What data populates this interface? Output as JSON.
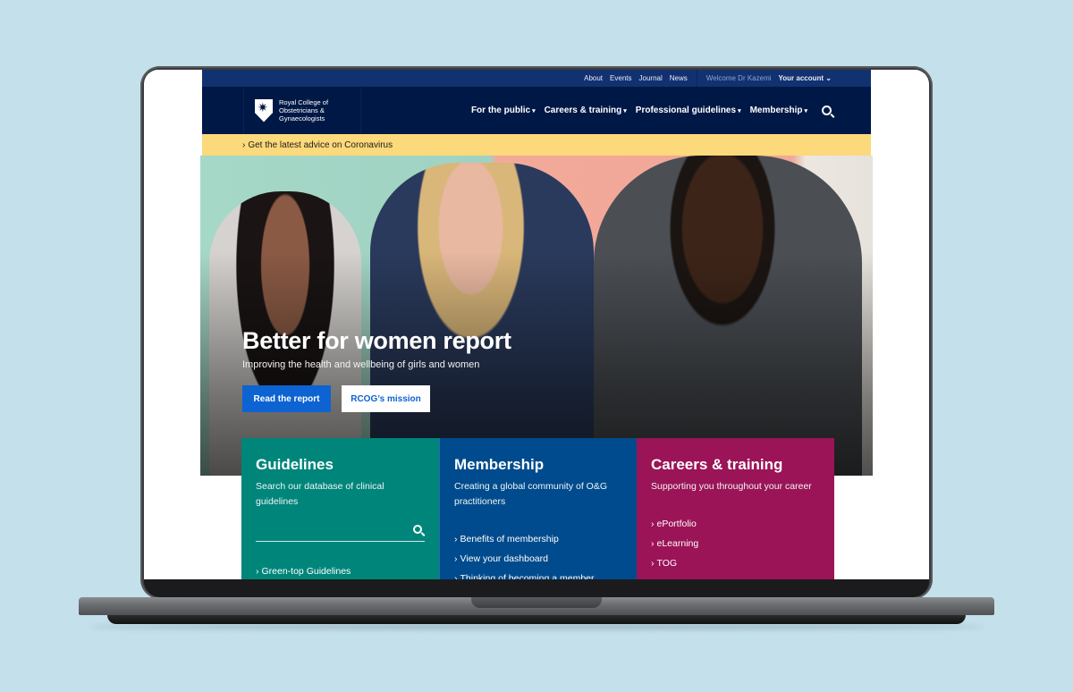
{
  "utility_nav": {
    "links": [
      "About",
      "Events",
      "Journal",
      "News"
    ],
    "welcome": "Welcome Dr Kazemi",
    "account": "Your account",
    "account_icon": "chevron-down-icon"
  },
  "brand": {
    "logo_icon": "shield-star-icon",
    "name_lines": [
      "Royal College of",
      "Obstetricians &",
      "Gynaecologists"
    ]
  },
  "main_nav": {
    "items": [
      {
        "label": "For the public",
        "icon": "caret-down-icon"
      },
      {
        "label": "Careers & training",
        "icon": "caret-down-icon"
      },
      {
        "label": "Professional guidelines",
        "icon": "caret-down-icon"
      },
      {
        "label": "Membership",
        "icon": "caret-down-icon"
      }
    ],
    "search_icon": "search-icon"
  },
  "alert_bar": {
    "chevron": "›",
    "text": "Get the latest advice on Coronavirus"
  },
  "hero": {
    "title": "Better for women report",
    "subtitle": "Improving the health and wellbeing of girls and women",
    "primary_button": "Read the report",
    "secondary_button": "RCOG’s mission"
  },
  "cards": [
    {
      "title": "Guidelines",
      "description": "Search our database of clinical guidelines",
      "search_placeholder": "",
      "links": [
        "Green-top Guidelines"
      ],
      "color": "#00857a"
    },
    {
      "title": "Membership",
      "description": "Creating a global community of O&G practitioners",
      "links": [
        "Benefits of membership",
        "View your dashboard",
        "Thinking of becoming a member"
      ],
      "color": "#004b8d"
    },
    {
      "title": "Careers & training",
      "description": "Supporting you throughout your career",
      "links": [
        "ePortfolio",
        "eLearning",
        "TOG"
      ],
      "color": "#9b1457"
    }
  ],
  "colors": {
    "navy": "#001846",
    "utility_blue": "#123171",
    "alert_yellow": "#fcd97a",
    "button_blue": "#0d63d1",
    "background": "#c4e0eb"
  }
}
